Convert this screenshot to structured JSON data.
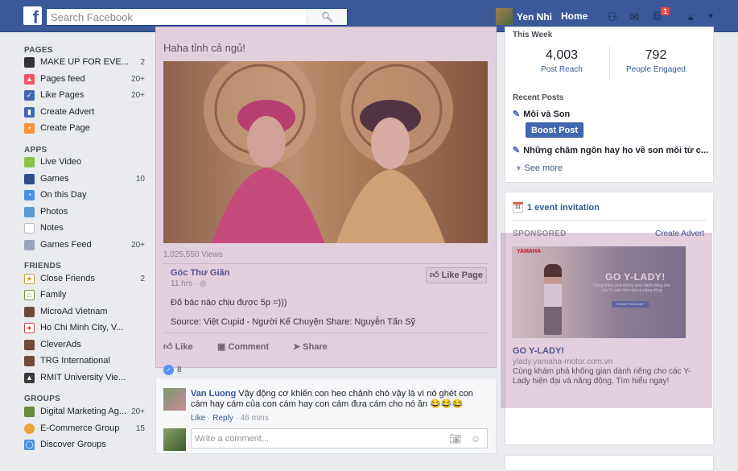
{
  "topbar": {
    "search_placeholder": "Search Facebook",
    "search_icon": "search-icon",
    "profile_name": "Yen Nhi",
    "home": "Home",
    "notif_count": "1",
    "colors": {
      "bar": "#3b5998"
    }
  },
  "sidebar": {
    "pages_header": "PAGES",
    "pages": [
      {
        "label": "MAKE UP FOR EVE...",
        "count": "2"
      },
      {
        "label": "Pages feed",
        "count": "20+"
      },
      {
        "label": "Like Pages",
        "count": "20+"
      },
      {
        "label": "Create Advert",
        "count": ""
      },
      {
        "label": "Create Page",
        "count": ""
      }
    ],
    "apps_header": "APPS",
    "apps": [
      {
        "label": "Live Video",
        "count": ""
      },
      {
        "label": "Games",
        "count": "10"
      },
      {
        "label": "On this Day",
        "count": ""
      },
      {
        "label": "Photos",
        "count": ""
      },
      {
        "label": "Notes",
        "count": ""
      },
      {
        "label": "Games Feed",
        "count": "20+"
      }
    ],
    "friends_header": "FRIENDS",
    "friends": [
      {
        "label": "Close Friends",
        "count": "2"
      },
      {
        "label": "Family",
        "count": ""
      },
      {
        "label": "MicroAd Vietnam",
        "count": ""
      },
      {
        "label": "Ho Chi Minh City, V...",
        "count": ""
      },
      {
        "label": "CleverAds",
        "count": ""
      },
      {
        "label": "TRG International",
        "count": ""
      },
      {
        "label": "RMIT University Vie...",
        "count": ""
      }
    ],
    "groups_header": "GROUPS",
    "groups": [
      {
        "label": "Digital Marketing Ag...",
        "count": "20+"
      },
      {
        "label": "E-Commerce Group",
        "count": "15"
      },
      {
        "label": "Discover Groups",
        "count": ""
      }
    ]
  },
  "post": {
    "text": "Haha tỉnh cả ngủ!",
    "views": "1,025,550 Views",
    "page_name": "Góc Thư Giãn",
    "page_time": "11 hrs · ◎",
    "like_page": "Like Page",
    "desc": "Đố bác nào chịu được 5p =)))",
    "source": "Source: Việt Cupid - Người Kể Chuyện Share: Nguyễn Tấn Sỹ",
    "actions": {
      "like": "Like",
      "comment": "Comment",
      "share": "Share"
    },
    "reactions": "8"
  },
  "comment": {
    "author": "Van Luong",
    "text": "Vậy động cơ khiến con heo chảnh chó vậy là vì nó ghét con cám hay cám của con cám hay con cám đưa cám cho nó ăn 😂😂😂",
    "like": "Like",
    "reply": "Reply",
    "time": "46 mins",
    "write_placeholder": "Write a comment..."
  },
  "insights": {
    "this_week": "This Week",
    "reach_num": "4,003",
    "reach_label": "Post Reach",
    "engaged_num": "792",
    "engaged_label": "People Engaged",
    "recent_posts": "Recent Posts",
    "post1": "Môi và Son",
    "boost": "Boost Post",
    "post2": "Những châm ngôn hay ho về son môi từ c...",
    "see_more": "See more"
  },
  "events": {
    "invitation": "1 event invitation",
    "cal_num": "31"
  },
  "ad": {
    "sponsored": "SPONSORED",
    "create_advert": "Create Advert",
    "logo": "YAMAHA",
    "headline": "GO Y-LADY!",
    "image_sub": "Cùng khám phá không gian dành riêng cho các Y-Lady hiện đại và năng động",
    "image_btn": "KHÁM PHÁ NGAY",
    "title": "GO Y-LADY!",
    "url": "ylady.yamaha-motor.com.vn",
    "desc": "Cùng khám phá không gian dành riêng cho các Y-Lady hiện đại và năng động. Tìm hiểu ngay!"
  }
}
